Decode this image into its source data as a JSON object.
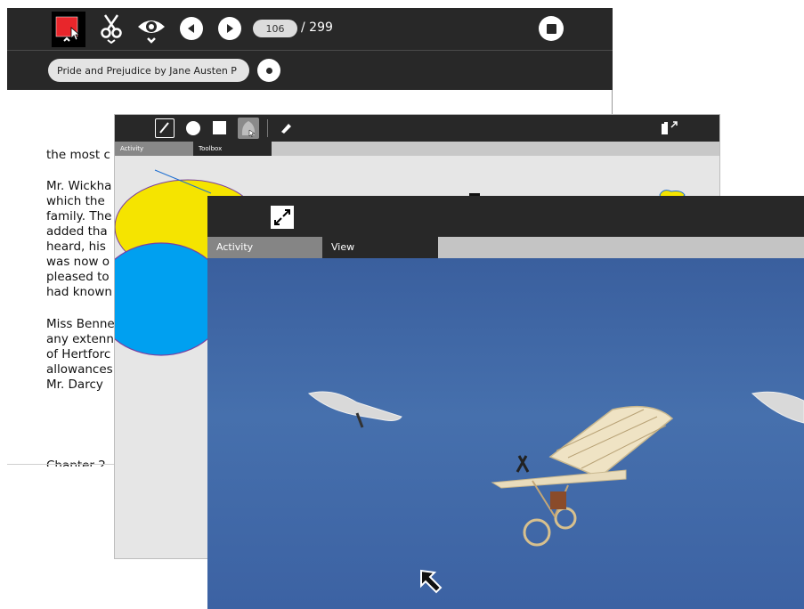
{
  "read": {
    "toolbar": {
      "page_current": "106",
      "page_total": "/ 299",
      "icons": [
        "activity-color-icon",
        "scissors-icon",
        "eye-icon",
        "prev-page-icon",
        "next-page-icon",
        "stop-icon"
      ]
    },
    "book_title": "Pride and Prejudice by Jane Austen P",
    "text_lines": [
      "the most c",
      "",
      "Mr. Wickha",
      "which the",
      "family. The",
      "added tha",
      "heard, his",
      "was now o",
      "pleased to",
      "had known",
      "",
      "Miss Benne",
      "any extenn",
      "of Hertforc",
      "allowances",
      "Mr. Darcy"
    ],
    "chapter_fragment": "Chapter 2"
  },
  "paint": {
    "tabs": [
      "Activity",
      "Toolbox"
    ],
    "colors": {
      "yellow": "#f5e400",
      "blue": "#00a0f0",
      "line": "#1e6fd1"
    }
  },
  "viewer": {
    "tabs": [
      "Activity",
      "View"
    ],
    "colors": {
      "sky": "#4670ad"
    }
  },
  "colors": {
    "toolbar_bg": "#282828",
    "accent_red": "#e8262b"
  }
}
